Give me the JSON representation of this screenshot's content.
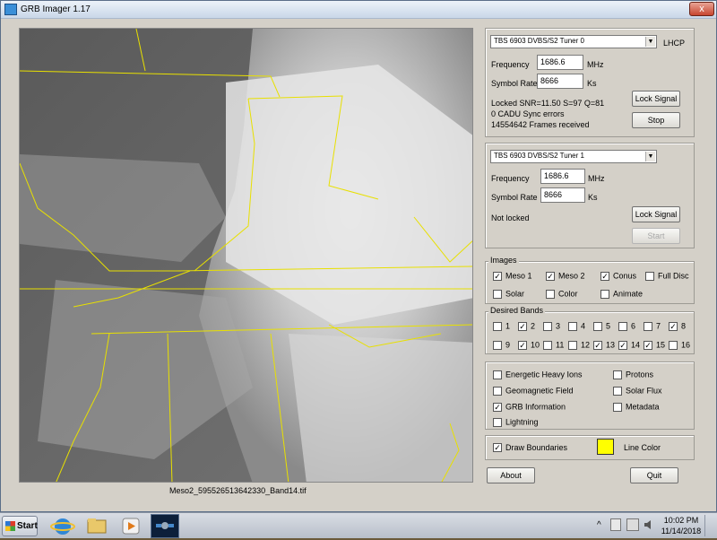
{
  "window": {
    "title": "GRB Imager 1.17",
    "close_glyph": "x"
  },
  "image": {
    "caption": "Meso2_595526513642330_Band14.tif"
  },
  "tuner0": {
    "device": "TBS 6903 DVBS/S2 Tuner 0",
    "polarization": "LHCP",
    "frequency_label": "Frequency",
    "frequency": "1686.6",
    "frequency_unit": "MHz",
    "symbol_rate_label": "Symbol Rate",
    "symbol_rate": "8666",
    "symbol_rate_unit": "Ks",
    "status_line1": "Locked  SNR=11.50 S=97 Q=81",
    "status_line2": "0 CADU Sync errors",
    "status_line3": "14554642 Frames received",
    "lock_button": "Lock Signal",
    "action_button": "Stop"
  },
  "tuner1": {
    "device": "TBS 6903 DVBS/S2 Tuner 1",
    "frequency_label": "Frequency",
    "frequency": "1686.6",
    "frequency_unit": "MHz",
    "symbol_rate_label": "Symbol Rate",
    "symbol_rate": "8666",
    "symbol_rate_unit": "Ks",
    "status": "Not locked",
    "lock_button": "Lock Signal",
    "action_button": "Start"
  },
  "images": {
    "legend": "Images",
    "items": [
      {
        "label": "Meso 1",
        "checked": true
      },
      {
        "label": "Meso 2",
        "checked": true
      },
      {
        "label": "Conus",
        "checked": true
      },
      {
        "label": "Full Disc",
        "checked": false
      },
      {
        "label": "Solar",
        "checked": false
      },
      {
        "label": "Color",
        "checked": false
      },
      {
        "label": "Animate",
        "checked": false
      }
    ]
  },
  "bands": {
    "legend": "Desired Bands",
    "items": [
      {
        "label": "1",
        "checked": false
      },
      {
        "label": "2",
        "checked": true
      },
      {
        "label": "3",
        "checked": false
      },
      {
        "label": "4",
        "checked": false
      },
      {
        "label": "5",
        "checked": false
      },
      {
        "label": "6",
        "checked": false
      },
      {
        "label": "7",
        "checked": false
      },
      {
        "label": "8",
        "checked": true
      },
      {
        "label": "9",
        "checked": false
      },
      {
        "label": "10",
        "checked": true
      },
      {
        "label": "11",
        "checked": false
      },
      {
        "label": "12",
        "checked": false
      },
      {
        "label": "13",
        "checked": true
      },
      {
        "label": "14",
        "checked": true
      },
      {
        "label": "15",
        "checked": true
      },
      {
        "label": "16",
        "checked": false
      }
    ]
  },
  "products": {
    "items": [
      {
        "label": "Energetic Heavy Ions",
        "checked": false
      },
      {
        "label": "Protons",
        "checked": false
      },
      {
        "label": "Geomagnetic Field",
        "checked": false
      },
      {
        "label": "Solar Flux",
        "checked": false
      },
      {
        "label": "GRB Information",
        "checked": true
      },
      {
        "label": "Metadata",
        "checked": false
      },
      {
        "label": "Lightning",
        "checked": false
      }
    ]
  },
  "boundaries": {
    "label": "Draw Boundaries",
    "checked": true,
    "line_color_label": "Line Color",
    "line_color": "#ffff00"
  },
  "buttons": {
    "about": "About",
    "quit": "Quit"
  },
  "taskbar": {
    "start": "Start",
    "time": "10:02 PM",
    "date": "11/14/2018",
    "tray_chevron": "^"
  }
}
